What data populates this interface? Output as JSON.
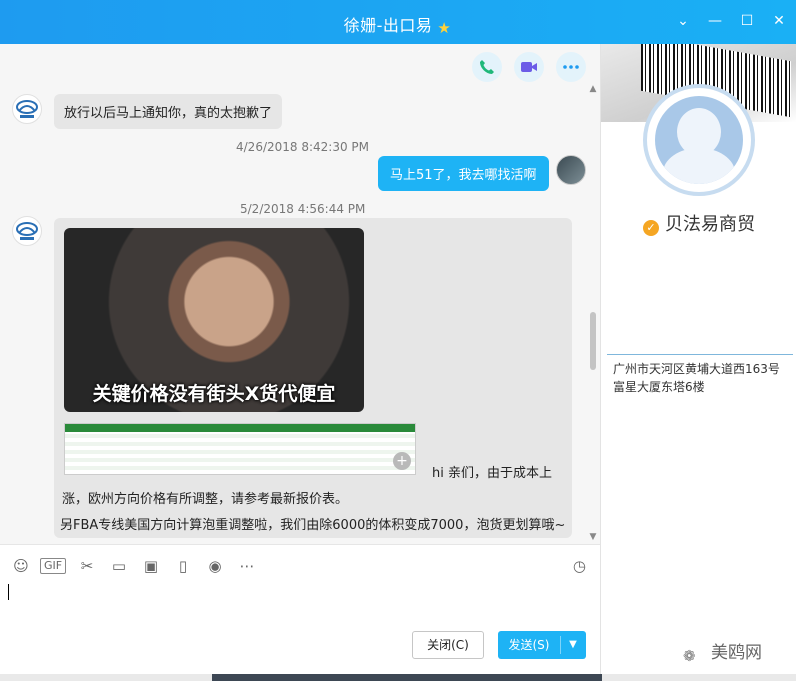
{
  "window": {
    "title": "徐姗-出口易",
    "star_icon": "star-icon",
    "controls": [
      "chevron-down-icon",
      "minimize-icon",
      "maximize-icon",
      "close-icon"
    ]
  },
  "call_tools": [
    "phone-icon",
    "video-icon",
    "more-icon"
  ],
  "messages": [
    {
      "from": "contact",
      "text": "放行以后马上通知你，真的太抱歉了"
    },
    {
      "timestamp": "4/26/2018 8:42:30 PM"
    },
    {
      "from": "me",
      "text": "马上51了，我去哪找活啊"
    },
    {
      "timestamp": "5/2/2018 4:56:44 PM"
    },
    {
      "from": "contact",
      "image_caption": "关键价格没有街头X货代便宜",
      "text_line1": "hi 亲们，由于成本上",
      "text_line2": "涨，欧州方向价格有所调整，请参考最新报价表。",
      "text_line3": "另FBA专线美国方向计算泡重调整啦，我们由除6000的体积变成7000，泡货更划算哦~"
    }
  ],
  "toolbar": {
    "tools": [
      "emoji-icon",
      "gif-icon",
      "scissors-icon",
      "folder-icon",
      "image-icon",
      "shake-icon",
      "red-packet-icon",
      "more-icon"
    ],
    "gif_label": "GIF",
    "history_icon": "clock-icon"
  },
  "buttons": {
    "close_label": "关闭(C)",
    "send_label": "发送(S)"
  },
  "profile": {
    "name": "贝法易商贸",
    "address": "广州市天河区黄埔大道西163号富星大厦东塔6楼"
  },
  "watermark": "美鸥网"
}
